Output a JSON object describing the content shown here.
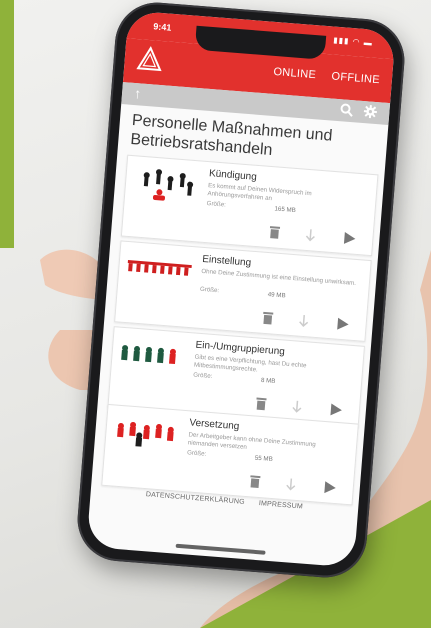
{
  "colors": {
    "brand_red": "#e2312d",
    "accent_green": "#8fb23a",
    "toolbar_gray": "#c9c9c9"
  },
  "statusbar": {
    "time": "9:41"
  },
  "appbar": {
    "logo_icon": "triangle-logo-icon",
    "nav": {
      "online": "ONLINE",
      "offline": "OFFLINE"
    }
  },
  "toolbar": {
    "back_icon": "arrow-up-icon",
    "search_icon": "search-icon",
    "settings_icon": "gear-icon"
  },
  "page": {
    "title": "Personelle Maßnahmen und Betriebsratshandeln"
  },
  "cards": [
    {
      "title": "Kündigung",
      "desc": "Es kommt auf Deinen Widerspruch im Anhörungsverfahren an",
      "size_label": "Größe:",
      "size": "165 MB"
    },
    {
      "title": "Einstellung",
      "desc": "Ohne Deine Zustimmung ist eine Einstellung unwirksam.",
      "size_label": "Größe:",
      "size": "49 MB"
    },
    {
      "title": "Ein-/Umgruppierung",
      "desc": "Gibt es eine Verpflichtung, hast Du echte Mitbestimmungsrechte.",
      "size_label": "Größe:",
      "size": "8 MB"
    },
    {
      "title": "Versetzung",
      "desc": "Der Arbeitgeber kann ohne Deine Zustimmung niemanden versetzen",
      "size_label": "Größe:",
      "size": "55 MB"
    }
  ],
  "card_actions": {
    "delete_icon": "trash-icon",
    "download_icon": "download-arrow-icon",
    "play_icon": "play-icon"
  },
  "footer": {
    "privacy": "DATENSCHUTZERKLÄRUNG",
    "imprint": "IMPRESSUM"
  }
}
